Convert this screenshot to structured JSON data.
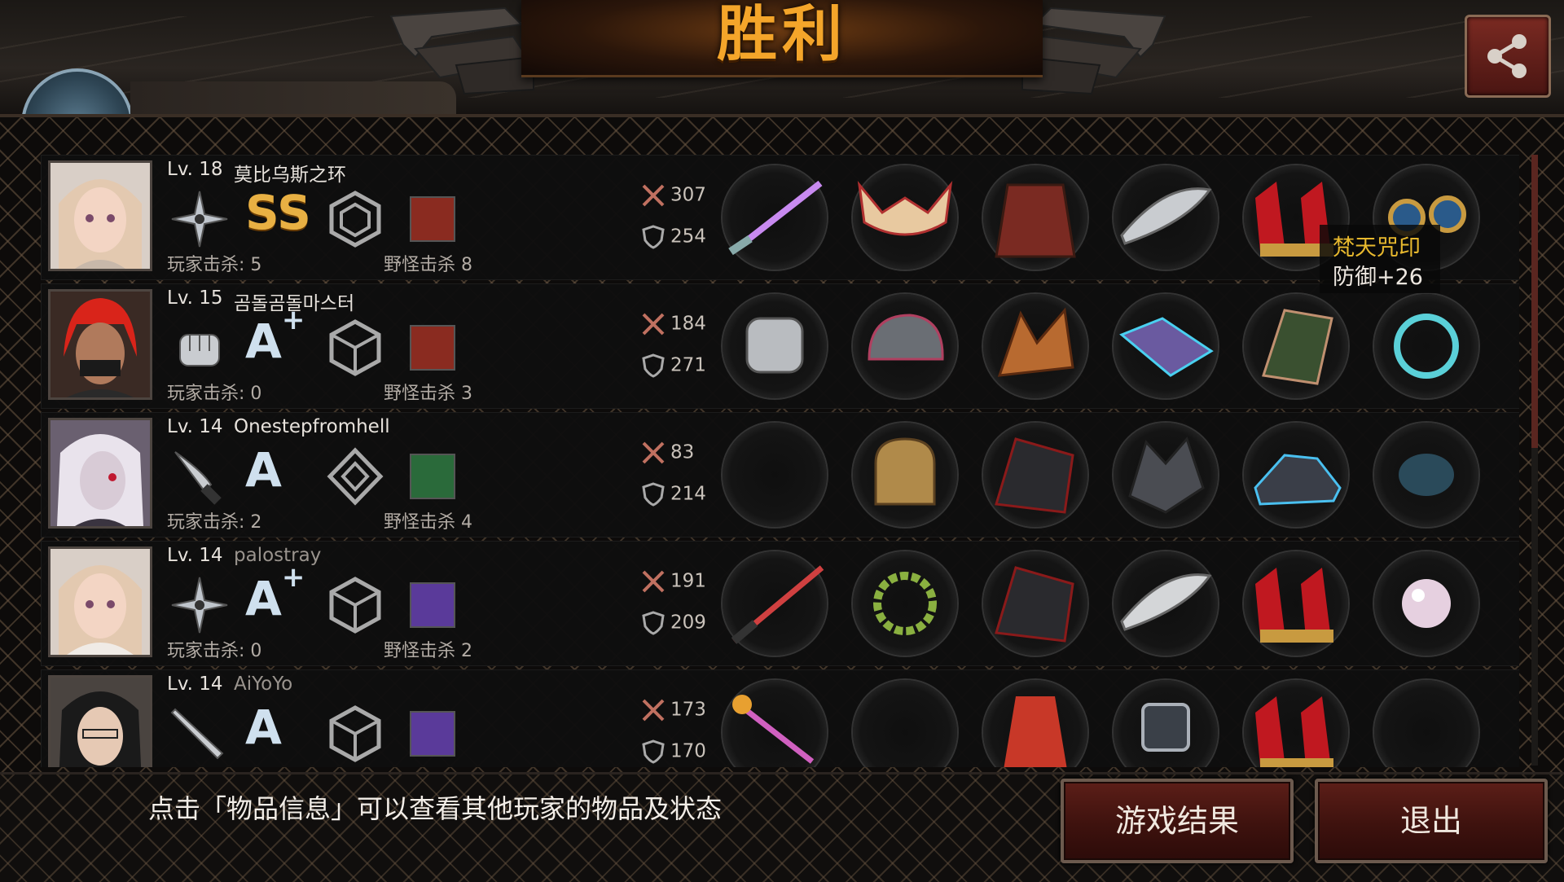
{
  "header": {
    "title": "胜利"
  },
  "players": [
    {
      "level": "Lv. 18",
      "name": "莫比乌斯之环",
      "grade": "SS",
      "grade_plus": "",
      "weapon_icon": "shuriken-icon",
      "atk": "307",
      "def": "254",
      "player_kills": "玩家击杀: 5",
      "monster_kills": "野怪击杀 8",
      "hair": "#e3c9b0",
      "skin": "#f3d5c4",
      "monster_color": "#8a2b20"
    },
    {
      "level": "Lv. 15",
      "name": "곰돌곰돌마스터",
      "grade": "A",
      "grade_plus": "+",
      "weapon_icon": "fist-icon",
      "atk": "184",
      "def": "271",
      "player_kills": "玩家击杀: 0",
      "monster_kills": "野怪击杀 3",
      "hair": "#d9241a",
      "skin": "#b07a5c",
      "monster_color": "#8a2b20"
    },
    {
      "level": "Lv. 14",
      "name": "Onestepfromhell",
      "grade": "A",
      "grade_plus": "",
      "weapon_icon": "knife-icon",
      "atk": "83",
      "def": "214",
      "player_kills": "玩家击杀: 2",
      "monster_kills": "野怪击杀 4",
      "hair": "#e9e3ec",
      "skin": "#d8cbd6",
      "monster_color": "#2a6a3a"
    },
    {
      "level": "Lv. 14",
      "name": "palostray",
      "grade": "A",
      "grade_plus": "+",
      "weapon_icon": "shuriken-icon",
      "atk": "191",
      "def": "209",
      "player_kills": "玩家击杀: 0",
      "monster_kills": "野怪击杀 2",
      "hair": "#e3c9b0",
      "skin": "#f3d5c4",
      "monster_color": "#5a3a9a"
    },
    {
      "level": "Lv. 14",
      "name": "AiYoYo",
      "grade": "A",
      "grade_plus": "",
      "weapon_icon": "bat-icon",
      "atk": "173",
      "def": "170",
      "player_kills": "",
      "monster_kills": "",
      "hair": "#1a1a1a",
      "skin": "#e6c9b4",
      "monster_color": "#5a3a9a"
    }
  ],
  "tooltip": {
    "name": "梵天咒印",
    "stat": "防御+26"
  },
  "footer": {
    "hint": "点击「物品信息」可以查看其他玩家的物品及状态",
    "result_button": "游戏结果",
    "exit_button": "退出"
  },
  "colors": {
    "title": "#f4a52a",
    "accent": "#5c1e18",
    "tooltip_name": "#e8b92e"
  }
}
